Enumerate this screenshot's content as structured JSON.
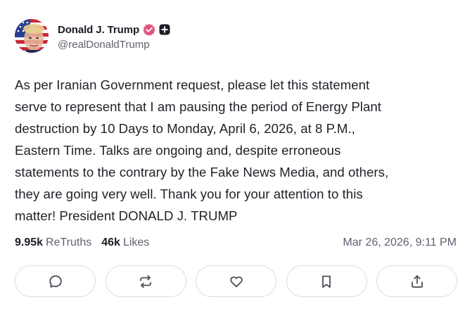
{
  "author": {
    "display_name": "Donald J. Trump",
    "handle": "@realDonaldTrump",
    "avatar": "american-flag-portrait",
    "verified_color": "#e2567c"
  },
  "post": {
    "text_lines": [
      "As per Iranian Government request, please let this statement",
      "serve to represent that I am pausing the period of Energy Plant",
      "destruction by 10 Days to Monday, April 6, 2026, at 8 P.M.,",
      "Eastern Time. Talks are ongoing and, despite erroneous",
      "statements to the contrary by the Fake News Media, and others,",
      "they are going very well. Thank you for your attention to this",
      "matter! President DONALD J. TRUMP"
    ]
  },
  "stats": {
    "retruths_count": "9.95k",
    "retruths_label": "ReTruths",
    "likes_count": "46k",
    "likes_label": "Likes",
    "timestamp": "Mar 26, 2026, 9:11 PM"
  },
  "actions": [
    {
      "icon": "reply-icon"
    },
    {
      "icon": "retruth-icon"
    },
    {
      "icon": "like-icon"
    },
    {
      "icon": "bookmark-icon"
    },
    {
      "icon": "share-icon"
    }
  ]
}
